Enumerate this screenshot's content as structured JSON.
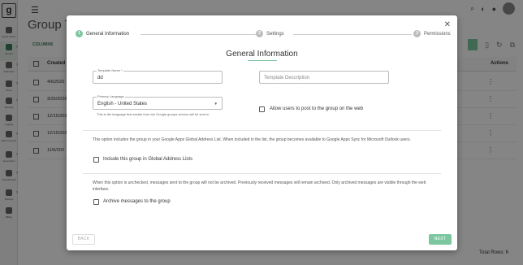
{
  "app": {
    "logo": "g",
    "page_title": "Group Te",
    "sidebar": [
      {
        "label": "Super Admin",
        "icon": "user-icon"
      },
      {
        "label": "Groups",
        "icon": "people-icon"
      },
      {
        "label": "Calendars",
        "icon": "calendar-icon"
      },
      {
        "label": "Drive",
        "icon": "drive-icon"
      },
      {
        "label": "Security",
        "icon": "security-icon"
      },
      {
        "label": "Logging",
        "icon": "log-icon"
      },
      {
        "label": "Report Center",
        "icon": "report-icon"
      },
      {
        "label": "Automation",
        "icon": "gear-icon"
      },
      {
        "label": "Import/Export",
        "icon": "import-icon"
      },
      {
        "label": "Settings",
        "icon": "settings-icon"
      },
      {
        "label": "Billing",
        "icon": "dollar-icon"
      }
    ],
    "toolbar": {
      "columns_label": "COLUMNS"
    },
    "table": {
      "header_created": "Created",
      "header_actions": "Actions",
      "rows": [
        "4/6/2026",
        "3/26/2026",
        "12/15/202",
        "12/15/202",
        "11/5/202"
      ]
    },
    "total_rows": "Total Rows: 6"
  },
  "modal": {
    "steps": [
      {
        "num": "1",
        "label": "General Information"
      },
      {
        "num": "2",
        "label": "Settings"
      },
      {
        "num": "3",
        "label": "Permissions"
      }
    ],
    "section_title": "General Information",
    "template_name": {
      "label": "Template Name *",
      "value": "dd"
    },
    "template_description": {
      "placeholder": "Template Description"
    },
    "primary_language": {
      "label": "Primary Language",
      "value": "English - United States",
      "helper": "This is the language that emails from the Google groups service will be sent in"
    },
    "allow_web_posting": {
      "label": "Allow users to post to the group on the web"
    },
    "gal_info": "This option includes the group in your Google Apps Global Address List. When included in the list, the group becomes available to Google Apps Sync for Microsoft Outlook users.",
    "include_gal": {
      "label": "Include this group in Global Address Lists"
    },
    "archive_info": "When this option is unchecked, messages sent to the group will not be archived. Previously received messages will remain archived. Only archived messages are visible through the web interface.",
    "archive": {
      "label": "Archive messages to the group"
    },
    "back_label": "BACK",
    "next_label": "NEXT"
  }
}
